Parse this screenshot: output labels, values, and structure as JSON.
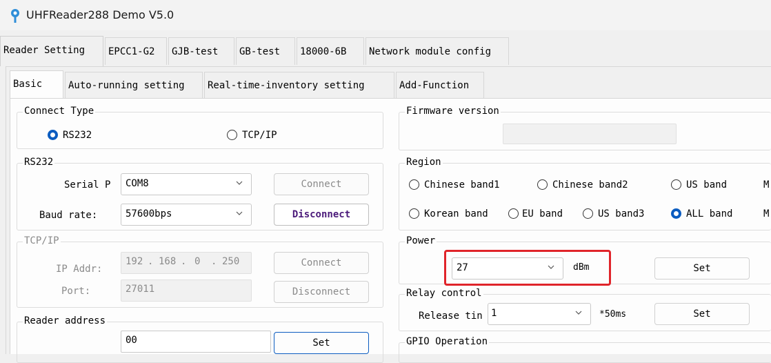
{
  "window": {
    "title": "UHFReader288 Demo V5.0"
  },
  "main_tabs": [
    "Reader Setting",
    "EPCC1-G2",
    "GJB-test",
    "GB-test",
    "18000-6B",
    "Network module config"
  ],
  "sub_tabs": [
    "Basic",
    "Auto-running setting",
    "Real-time-inventory setting",
    "Add-Function"
  ],
  "connect_type": {
    "legend": "Connect Type",
    "options": [
      "RS232",
      "TCP/IP"
    ],
    "selected": "RS232"
  },
  "rs232": {
    "legend": "RS232",
    "serial_label": "Serial P",
    "serial_value": "COM8",
    "baud_label": "Baud rate:",
    "baud_value": "57600bps",
    "connect_label": "Connect",
    "disconnect_label": "Disconnect"
  },
  "tcpip": {
    "legend": "TCP/IP",
    "ip_label": "IP Addr:",
    "ip": [
      "192",
      "168",
      "0",
      "250"
    ],
    "port_label": "Port:",
    "port_value": "27011",
    "connect_label": "Connect",
    "disconnect_label": "Disconnect"
  },
  "reader_address": {
    "legend": "Reader address",
    "value": "00",
    "set_label": "Set"
  },
  "firmware": {
    "legend": "Firmware version",
    "value": ""
  },
  "region": {
    "legend": "Region",
    "row1": [
      "Chinese band1",
      "Chinese band2",
      "US band"
    ],
    "row2": [
      "Korean band",
      "EU band",
      "US band3",
      "ALL band"
    ],
    "selected": "ALL band",
    "cut1": "M",
    "cut2": "M"
  },
  "power": {
    "legend": "Power",
    "value": "27",
    "unit": "dBm",
    "set_label": "Set"
  },
  "relay": {
    "legend": "Relay control",
    "release_label": "Release tin",
    "release_value": "1",
    "unit": "*50ms",
    "set_label": "Set"
  },
  "gpio": {
    "legend": "GPIO Operation"
  },
  "colors": {
    "accent": "#0b5cc0",
    "highlight_box": "#e0242a",
    "disconnect_text": "#4b1a7a"
  }
}
